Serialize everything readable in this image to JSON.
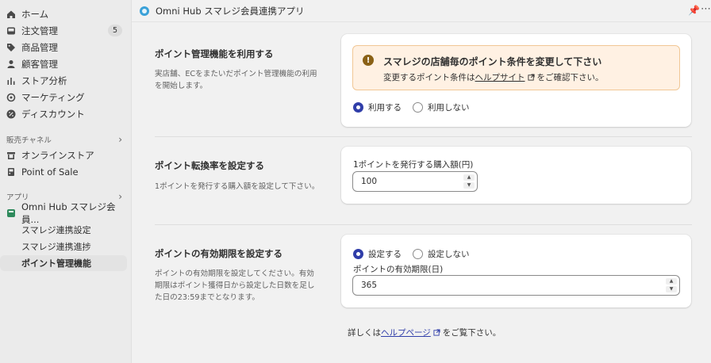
{
  "sidebar": {
    "items": [
      {
        "label": "ホーム",
        "icon": "home-icon"
      },
      {
        "label": "注文管理",
        "icon": "inbox-icon",
        "badge": "5"
      },
      {
        "label": "商品管理",
        "icon": "tag-icon"
      },
      {
        "label": "顧客管理",
        "icon": "person-icon"
      },
      {
        "label": "ストア分析",
        "icon": "bar-chart-icon"
      },
      {
        "label": "マーケティング",
        "icon": "target-icon"
      },
      {
        "label": "ディスカウント",
        "icon": "discount-icon"
      }
    ],
    "sales_channels": {
      "heading": "販売チャネル",
      "items": [
        {
          "label": "オンラインストア",
          "icon": "store-icon"
        },
        {
          "label": "Point of Sale",
          "icon": "pos-icon"
        }
      ]
    },
    "apps": {
      "heading": "アプリ",
      "app_name": "Omni Hub スマレジ会員...",
      "sub_items": [
        "スマレジ連携設定",
        "スマレジ連携進捗",
        "ポイント管理機能"
      ]
    }
  },
  "topbar": {
    "title": "Omni Hub スマレジ会員連携アプリ",
    "more": "⋯"
  },
  "sections": {
    "use": {
      "title": "ポイント管理機能を利用する",
      "desc": "実店舗、ECをまたいだポイント管理機能の利用を開始します。",
      "banner_title": "スマレジの店舗毎のポイント条件を変更して下さい",
      "banner_text_pre": "変更するポイント条件は",
      "banner_link": "ヘルプサイト",
      "banner_text_post": "をご確認下さい。",
      "radio_on": "利用する",
      "radio_off": "利用しない"
    },
    "rate": {
      "title": "ポイント転換率を設定する",
      "desc": "1ポイントを発行する購入額を設定して下さい。",
      "field_label": "1ポイントを発行する購入額(円)",
      "value": "100"
    },
    "expiry": {
      "title": "ポイントの有効期限を設定する",
      "desc": "ポイントの有効期限を設定してください。有効期限はポイント獲得日から設定した日数を足した日の23:59までとなります。",
      "radio_on": "設定する",
      "radio_off": "設定しない",
      "field_label": "ポイントの有効期限(日)",
      "value": "365"
    }
  },
  "footer": {
    "pre": "詳しくは",
    "link": "ヘルプページ",
    "post": "をご覧下さい。"
  },
  "colors": {
    "accent": "#303ea9",
    "warning_bg": "#fff1e3",
    "warning_border": "#f1c795"
  }
}
